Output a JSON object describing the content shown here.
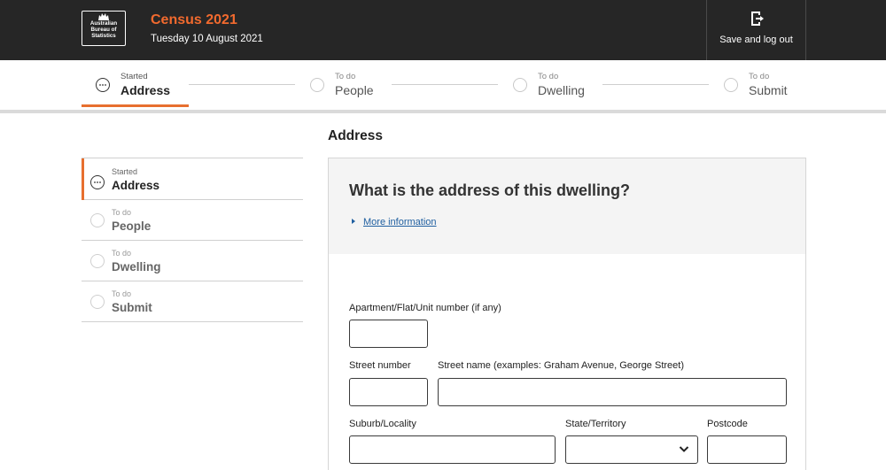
{
  "header": {
    "logo_lines": [
      "Australian",
      "Bureau of",
      "Statistics"
    ],
    "title": "Census 2021",
    "date": "Tuesday 10 August 2021",
    "save_logout_label": "Save and log out",
    "accent_color": "#f26a2e"
  },
  "progress": {
    "steps": [
      {
        "status": "Started",
        "name": "Address",
        "active": true
      },
      {
        "status": "To do",
        "name": "People",
        "active": false
      },
      {
        "status": "To do",
        "name": "Dwelling",
        "active": false
      },
      {
        "status": "To do",
        "name": "Submit",
        "active": false
      }
    ]
  },
  "sidebar": {
    "items": [
      {
        "status": "Started",
        "name": "Address",
        "active": true
      },
      {
        "status": "To do",
        "name": "People",
        "active": false
      },
      {
        "status": "To do",
        "name": "Dwelling",
        "active": false
      },
      {
        "status": "To do",
        "name": "Submit",
        "active": false
      }
    ]
  },
  "main": {
    "section_title": "Address",
    "question": "What is the address of this dwelling?",
    "more_info": "More information",
    "fields": {
      "unit_label": "Apartment/Flat/Unit number (if any)",
      "street_number_label": "Street number",
      "street_name_label": "Street name (examples: Graham Avenue, George Street)",
      "suburb_label": "Suburb/Locality",
      "state_label": "State/Territory",
      "postcode_label": "Postcode",
      "unit_value": "",
      "street_number_value": "",
      "street_name_value": "",
      "suburb_value": "",
      "state_value": "",
      "postcode_value": ""
    }
  }
}
